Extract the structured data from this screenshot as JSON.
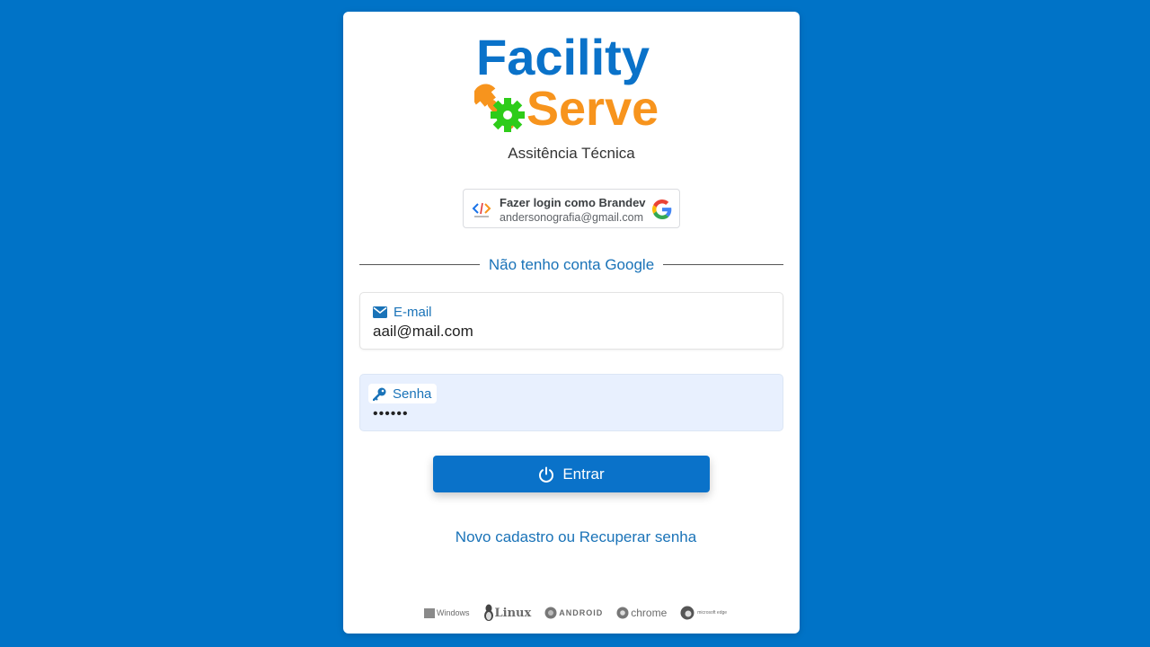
{
  "brand": {
    "logo_line1": "Facility",
    "logo_line2": "Serve",
    "subtitle": "Assitência Técnica",
    "colors": {
      "primary": "#0a72c9",
      "accent": "#f7941d",
      "gear": "#2ecc1a",
      "background": "#0073c7"
    }
  },
  "google_login": {
    "title": "Fazer login como Brandev",
    "email": "andersonografia@gmail.com",
    "app_icon": "code-brackets-icon",
    "provider_icon": "google-g-icon"
  },
  "divider": {
    "text": "Não tenho conta Google"
  },
  "email_field": {
    "label": "E-mail",
    "value": "aail@mail.com",
    "icon": "envelope-icon"
  },
  "password_field": {
    "label": "Senha",
    "value": "••••••",
    "icon": "key-icon"
  },
  "submit": {
    "label": "Entrar",
    "icon": "power-icon"
  },
  "footer_link": "Novo cadastro ou Recuperar senha",
  "platforms": [
    {
      "name": "Windows",
      "icon": "windows-icon"
    },
    {
      "name": "Linux",
      "icon": "linux-tux-icon"
    },
    {
      "name": "ANDROID",
      "icon": "android-icon"
    },
    {
      "name": "chrome",
      "icon": "chrome-icon"
    },
    {
      "name": "microsoft edge",
      "icon": "edge-icon"
    }
  ]
}
